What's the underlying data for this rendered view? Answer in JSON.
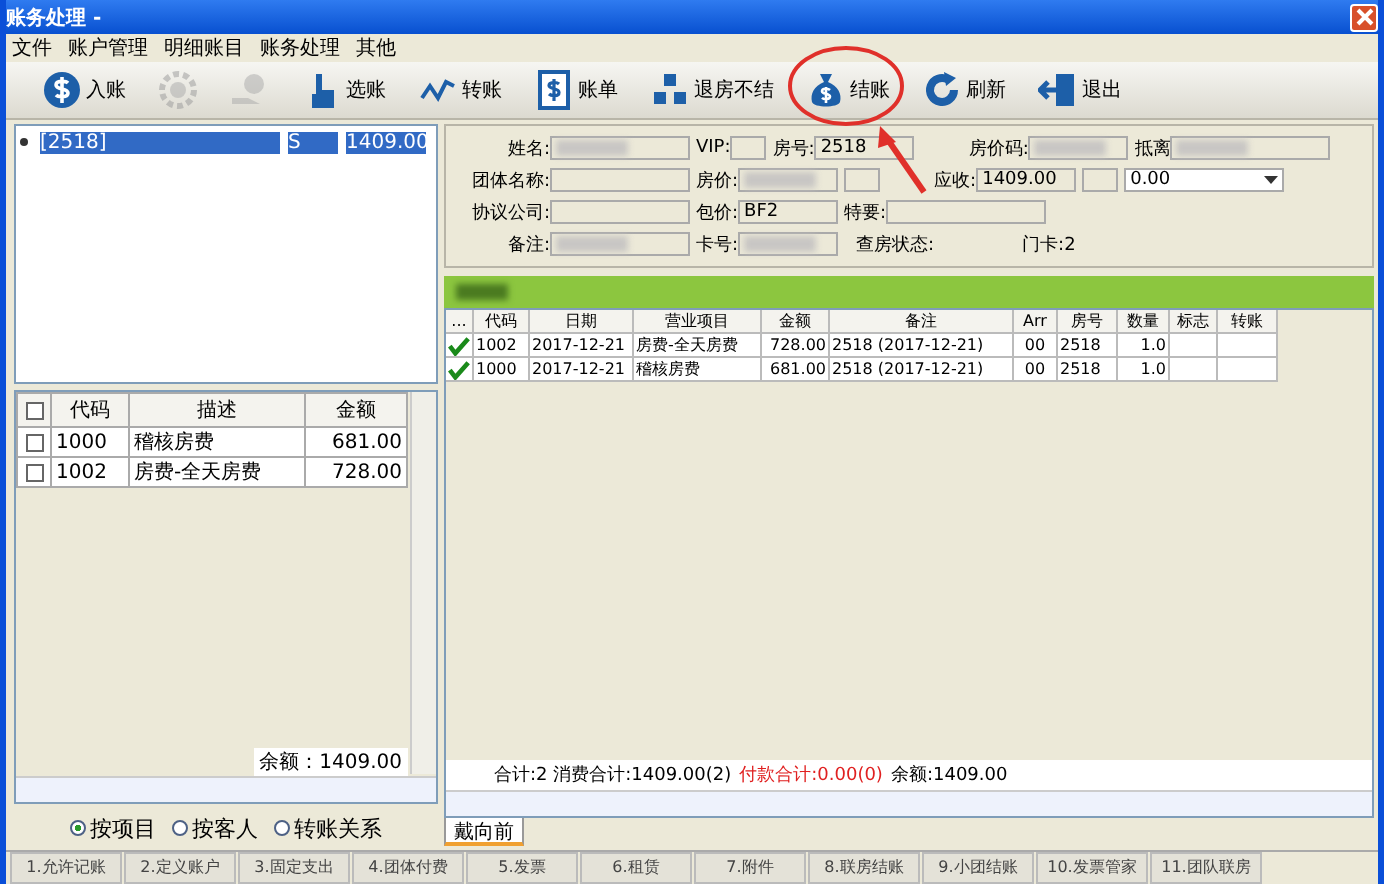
{
  "window": {
    "title": "账务处理 -"
  },
  "menu": [
    "文件",
    "账户管理",
    "明细账目",
    "账务处理",
    "其他"
  ],
  "toolbar": [
    {
      "kind": "dollar",
      "label": "入账",
      "disabled": false
    },
    {
      "kind": "gear",
      "disabled": true
    },
    {
      "kind": "coin-hand",
      "disabled": true
    },
    {
      "kind": "pointer",
      "label": "选账",
      "disabled": false
    },
    {
      "kind": "transfer",
      "label": "转账",
      "disabled": false
    },
    {
      "kind": "bill",
      "label": "账单",
      "disabled": false
    },
    {
      "kind": "blocks",
      "label": "退房不结",
      "disabled": false
    },
    {
      "kind": "moneybag",
      "label": "结账",
      "disabled": false
    },
    {
      "kind": "refresh",
      "label": "刷新",
      "disabled": false
    },
    {
      "kind": "exit",
      "label": "退出",
      "disabled": false
    }
  ],
  "room_list": [
    {
      "room": "[2518]",
      "status": "S",
      "amount": "1409.00",
      "selected": true
    }
  ],
  "left_table": {
    "columns": [
      "代码",
      "描述",
      "金额"
    ],
    "all_checked": false,
    "rows": [
      {
        "checked": false,
        "cells": [
          "1000",
          "稽核房费",
          "681.00"
        ]
      },
      {
        "checked": false,
        "cells": [
          "1002",
          "房费-全天房费",
          "728.00"
        ]
      }
    ]
  },
  "left_balance": "余额：1409.00",
  "radios": [
    {
      "label": "按项目",
      "selected": true
    },
    {
      "label": "按客人",
      "selected": false
    },
    {
      "label": "转账关系",
      "selected": false
    }
  ],
  "form": [
    [
      {
        "kind": "field",
        "label": "姓名:",
        "redacted": true
      },
      {
        "kind": "short",
        "label": "VIP:"
      },
      {
        "kind": "field",
        "label": "房号:",
        "value": "2518"
      },
      {
        "kind": "field",
        "label": "房价码:",
        "redacted": true
      },
      {
        "kind": "wide",
        "label": "抵离",
        "redacted": true
      }
    ],
    [
      {
        "kind": "field",
        "label": "团体名称:"
      },
      {
        "kind": "field",
        "label": "房价:",
        "redacted": true
      },
      {
        "kind": "short"
      },
      {
        "kind": "field",
        "label": "应收:",
        "value": "1409.00"
      },
      {
        "kind": "short"
      },
      {
        "kind": "dropdown",
        "value": "0.00"
      }
    ],
    [
      {
        "kind": "field",
        "label": "协议公司:"
      },
      {
        "kind": "field",
        "label": "包价:",
        "value": "BF2"
      },
      {
        "kind": "wide",
        "label": "特要:"
      }
    ],
    [
      {
        "kind": "field",
        "label": "备注:",
        "redacted": true
      },
      {
        "kind": "field",
        "label": "卡号:",
        "redacted": true
      },
      {
        "kind": "text",
        "label": "查房状态:"
      },
      {
        "kind": "text",
        "label": "门卡:2"
      }
    ]
  ],
  "table": {
    "check_column": "...",
    "columns": [
      "代码",
      "日期",
      "营业项目",
      "金额",
      "备注",
      "Arr",
      "房号",
      "数量",
      "标志",
      "转账"
    ],
    "rows": [
      {
        "checked": true,
        "cells": [
          "1002",
          "2017-12-21",
          "房费-全天房费",
          "728.00",
          "2518 (2017-12-21)",
          "00",
          "2518",
          "1.0",
          "",
          ""
        ]
      },
      {
        "checked": true,
        "cells": [
          "1000",
          "2017-12-21",
          "稽核房费",
          "681.00",
          "2518 (2017-12-21)",
          "00",
          "2518",
          "1.0",
          "",
          ""
        ]
      }
    ]
  },
  "summary": [
    {
      "kind": "normal",
      "text": "合计:2 消费合计:1409.00(2)"
    },
    {
      "kind": "alert",
      "text": "付款合计:0.00(0)"
    },
    {
      "kind": "normal",
      "text": "余额:1409.00"
    }
  ],
  "operator_tabs": [
    {
      "label": "戴向前",
      "selected": true
    }
  ],
  "bottom_tabs": [
    {
      "label": "1.允许记账",
      "selected": false
    },
    {
      "label": "2.定义账户",
      "selected": false
    },
    {
      "label": "3.固定支出",
      "selected": false
    },
    {
      "label": "4.团体付费",
      "selected": false
    },
    {
      "label": "5.发票",
      "selected": false
    },
    {
      "label": "6.租赁",
      "selected": false
    },
    {
      "label": "7.附件",
      "selected": false
    },
    {
      "label": "8.联房结账",
      "selected": false
    },
    {
      "label": "9.小团结账",
      "selected": false
    },
    {
      "label": "10.发票管家",
      "selected": false
    },
    {
      "label": "11.团队联房",
      "selected": false
    }
  ]
}
